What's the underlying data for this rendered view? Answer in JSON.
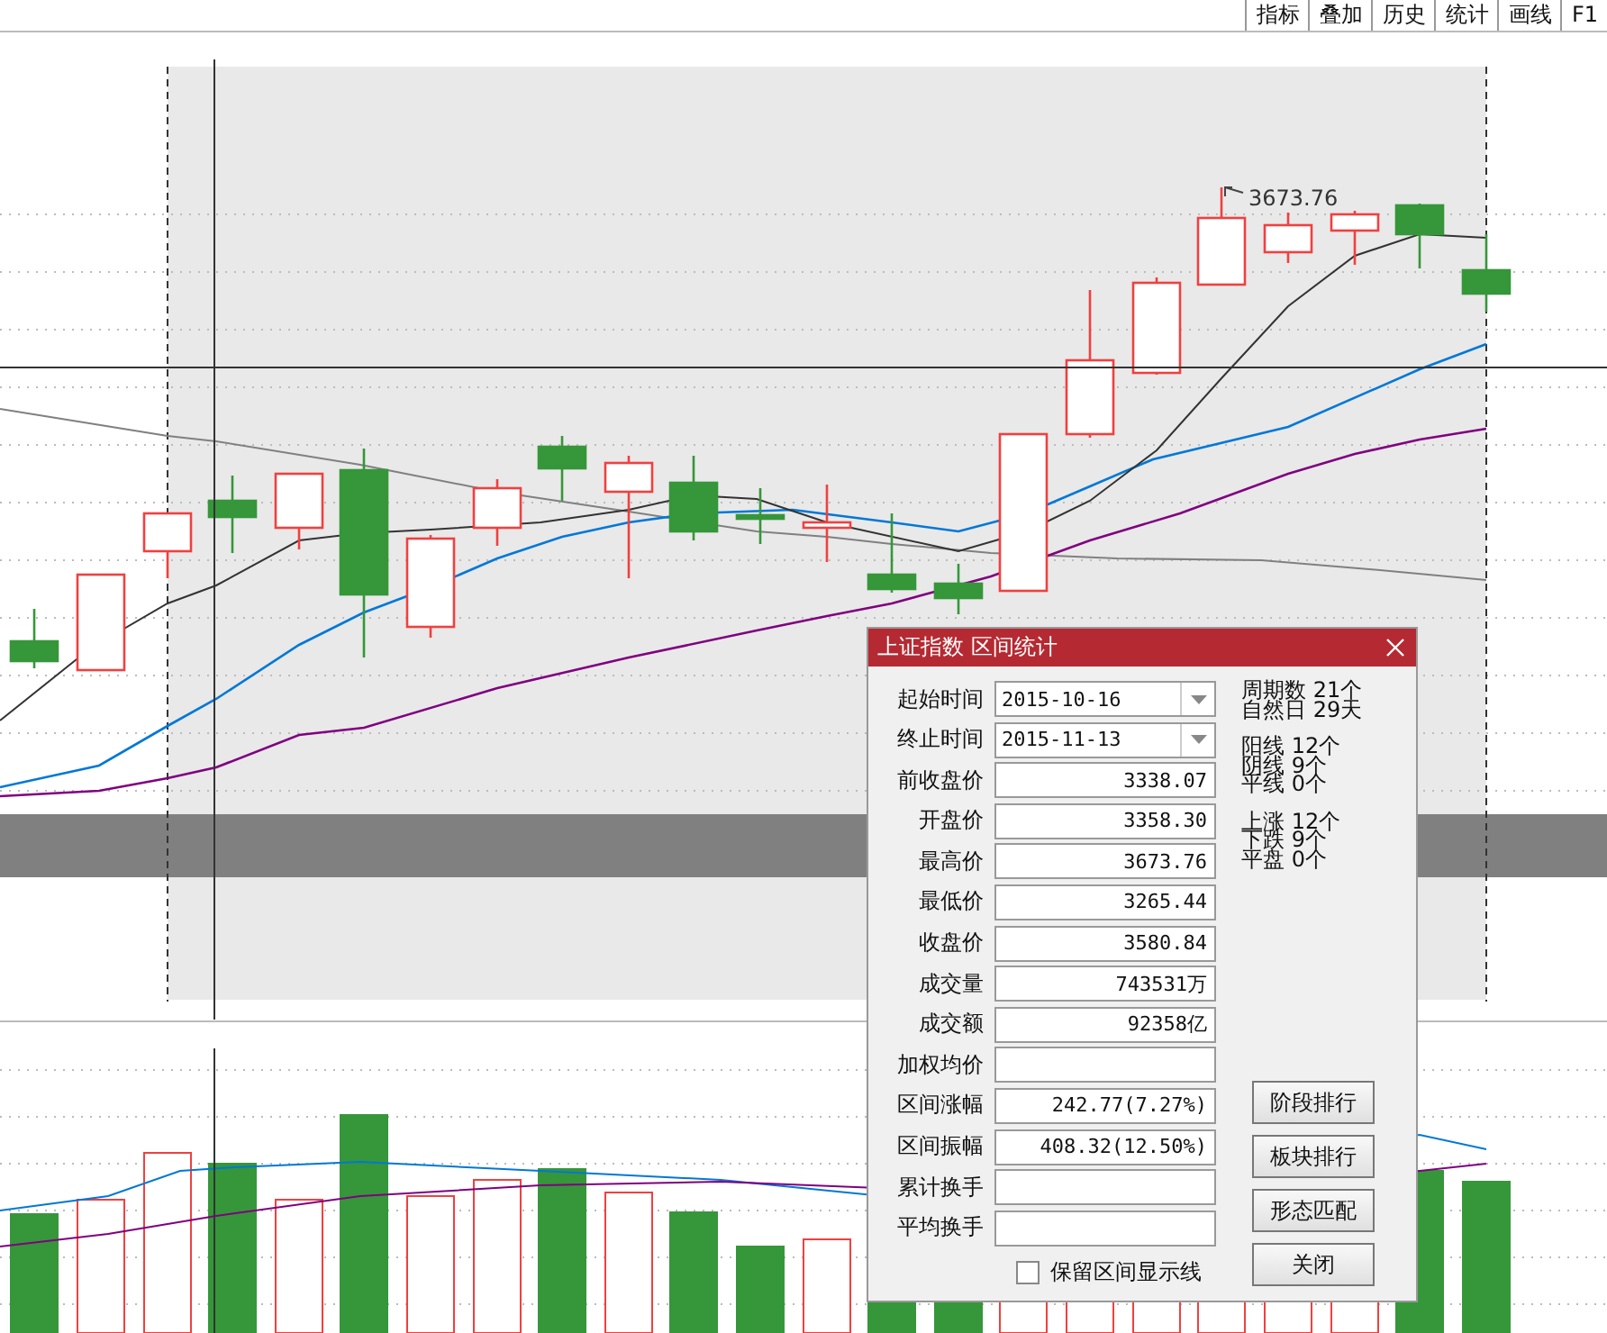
{
  "toolbar": {
    "tabs": [
      "指标",
      "叠加",
      "历史",
      "统计",
      "画线",
      "F1"
    ]
  },
  "chart": {
    "peak_label": "3673.76"
  },
  "dialog": {
    "title": "上证指数 区间统计",
    "fields": [
      {
        "label": "起始时间",
        "value": "2015-10-16",
        "kind": "dropdown"
      },
      {
        "label": "终止时间",
        "value": "2015-11-13",
        "kind": "dropdown"
      },
      {
        "label": "前收盘价",
        "value": "3338.07",
        "kind": "text"
      },
      {
        "label": "开盘价",
        "value": "3358.30",
        "kind": "text"
      },
      {
        "label": "最高价",
        "value": "3673.76",
        "kind": "text"
      },
      {
        "label": "最低价",
        "value": "3265.44",
        "kind": "text"
      },
      {
        "label": "收盘价",
        "value": "3580.84",
        "kind": "text"
      },
      {
        "label": "成交量",
        "value": "743531万",
        "kind": "text"
      },
      {
        "label": "成交额",
        "value": "92358亿",
        "kind": "text"
      },
      {
        "label": "加权均价",
        "kind": "text"
      },
      {
        "label": "区间涨幅",
        "value": "242.77(7.27%)",
        "kind": "text"
      },
      {
        "label": "区间振幅",
        "value": "408.32(12.50%)",
        "kind": "text"
      },
      {
        "label": "累计换手",
        "kind": "text"
      },
      {
        "label": "平均换手",
        "kind": "text"
      }
    ],
    "stats": [
      [
        {
          "label": "周期数",
          "value": "21个"
        },
        {
          "label": "自然日",
          "value": "29天"
        }
      ],
      [
        {
          "label": "阳线",
          "value": "12个"
        },
        {
          "label": "阴线",
          "value": "9个"
        },
        {
          "label": "平线",
          "value": "0个"
        }
      ],
      [
        {
          "label": "上涨",
          "value": "12个"
        },
        {
          "label": "下跌",
          "value": "9个"
        },
        {
          "label": "平盘",
          "value": "0个"
        }
      ]
    ],
    "buttons": [
      "阶段排行",
      "板块排行",
      "形态匹配",
      "关闭"
    ],
    "checkbox": {
      "label": "保留区间显示线",
      "checked": false
    }
  }
}
